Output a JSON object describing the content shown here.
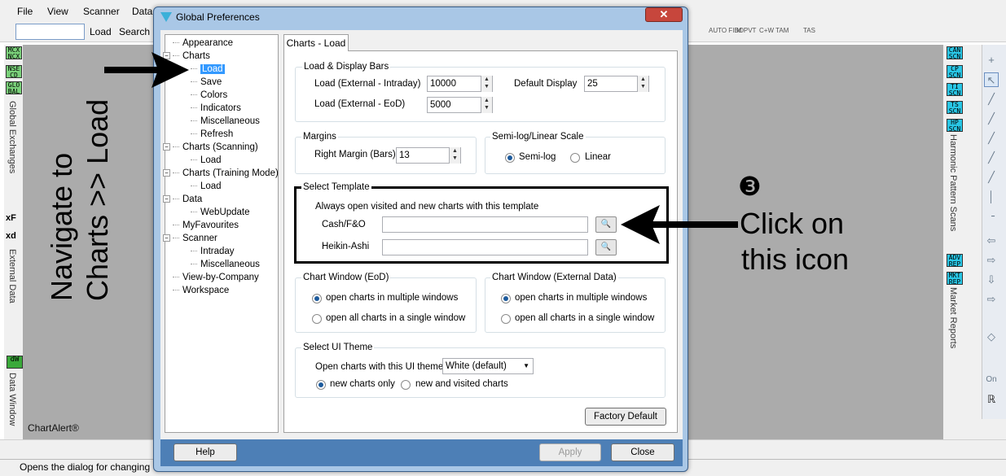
{
  "menubar": {
    "items": [
      "File",
      "View",
      "Scanner",
      "Data"
    ]
  },
  "toolbar": {
    "search_value": "",
    "load_label": "Load",
    "search_label": "Search"
  },
  "left_strip": {
    "tabs": [
      "MCX\nNCX",
      "NSE\nCD",
      "GLO\nBAL"
    ],
    "label_global": "Global Exchanges",
    "ext_tab_1": "xF",
    "ext_tab_2": "xd",
    "label_external": "External Data",
    "dw_tab": "dW",
    "label_datawindow": "Data Window"
  },
  "watermark": "ChartAlert®",
  "right_panel": {
    "tabs": [
      "CAN\nSCN",
      "CP\nSCN",
      "TI\nSCN",
      "TS\nSCN",
      "HP\nSCN"
    ],
    "label_harmonic": "Harmonic Pattern Scans",
    "report_tabs": [
      "ADV\nREP",
      "MKT\nREP"
    ],
    "label_market": "Market Reports",
    "tools": [
      "+",
      "↖",
      "╱",
      "╱",
      "╱",
      "╱",
      "╱",
      "╱",
      "╱",
      "╱",
      "│",
      "╶",
      "⇦",
      "⇨",
      "⇩",
      "⇨",
      "◇",
      "On",
      "ℝ"
    ]
  },
  "right_toolbar_top": {
    "items": [
      "AUTO FIBO",
      "M PVT",
      "C+W TAM",
      "TAS"
    ]
  },
  "status_text": "Opens the dialog for changing",
  "dialog": {
    "title": "Global Preferences",
    "close_label": "✕",
    "tree": [
      {
        "label": "Appearance",
        "level": 0
      },
      {
        "label": "Charts",
        "level": 0,
        "expander": "−"
      },
      {
        "label": "Load",
        "level": 1,
        "selected": true
      },
      {
        "label": "Save",
        "level": 1
      },
      {
        "label": "Colors",
        "level": 1
      },
      {
        "label": "Indicators",
        "level": 1
      },
      {
        "label": "Miscellaneous",
        "level": 1
      },
      {
        "label": "Refresh",
        "level": 1
      },
      {
        "label": "Charts (Scanning)",
        "level": 0,
        "expander": "−"
      },
      {
        "label": "Load",
        "level": 1
      },
      {
        "label": "Charts (Training Mode)",
        "level": 0,
        "expander": "−"
      },
      {
        "label": "Load",
        "level": 1
      },
      {
        "label": "Data",
        "level": 0,
        "expander": "−"
      },
      {
        "label": "WebUpdate",
        "level": 1
      },
      {
        "label": "MyFavourites",
        "level": 0
      },
      {
        "label": "Scanner",
        "level": 0,
        "expander": "−"
      },
      {
        "label": "Intraday",
        "level": 1
      },
      {
        "label": "Miscellaneous",
        "level": 1
      },
      {
        "label": "View-by-Company",
        "level": 0
      },
      {
        "label": "Workspace",
        "level": 0
      }
    ],
    "tab_label": "Charts - Load",
    "load_display": {
      "title": "Load & Display Bars",
      "intraday_label": "Load (External - Intraday)",
      "intraday_value": "10000",
      "eod_label": "Load (External - EoD)",
      "eod_value": "5000",
      "default_display_label": "Default Display",
      "default_display_value": "25"
    },
    "margins": {
      "title": "Margins",
      "right_label": "Right Margin (Bars)",
      "right_value": "13"
    },
    "scale": {
      "title": "Semi-log/Linear Scale",
      "semilog_label": "Semi-log",
      "linear_label": "Linear",
      "selected": "Semi-log"
    },
    "template": {
      "title": "Select Template",
      "note": "Always open visited and new charts with this template",
      "cash_label": "Cash/F&O",
      "cash_value": "",
      "heikin_label": "Heikin-Ashi",
      "heikin_value": ""
    },
    "window_eod": {
      "title": "Chart Window (EoD)",
      "opt1": "open charts in multiple windows",
      "opt2": "open all charts in a single window",
      "selected": 1
    },
    "window_ext": {
      "title": "Chart Window (External Data)",
      "opt1": "open charts in multiple windows",
      "opt2": "open all charts in a single window",
      "selected": 1
    },
    "ui_theme": {
      "title": "Select UI Theme",
      "label": "Open charts with this UI theme",
      "value": "White (default)",
      "opt1": "new charts only",
      "opt2": "new and visited charts",
      "selected": 1
    },
    "factory_default_label": "Factory Default",
    "help_label": "Help",
    "apply_label": "Apply",
    "close_button_label": "Close"
  },
  "annotations": {
    "navigate_line1": "Navigate to",
    "navigate_line2": "Charts >> Load",
    "step_number": "❸",
    "click_line1": "Click on",
    "click_line2": "this icon"
  }
}
